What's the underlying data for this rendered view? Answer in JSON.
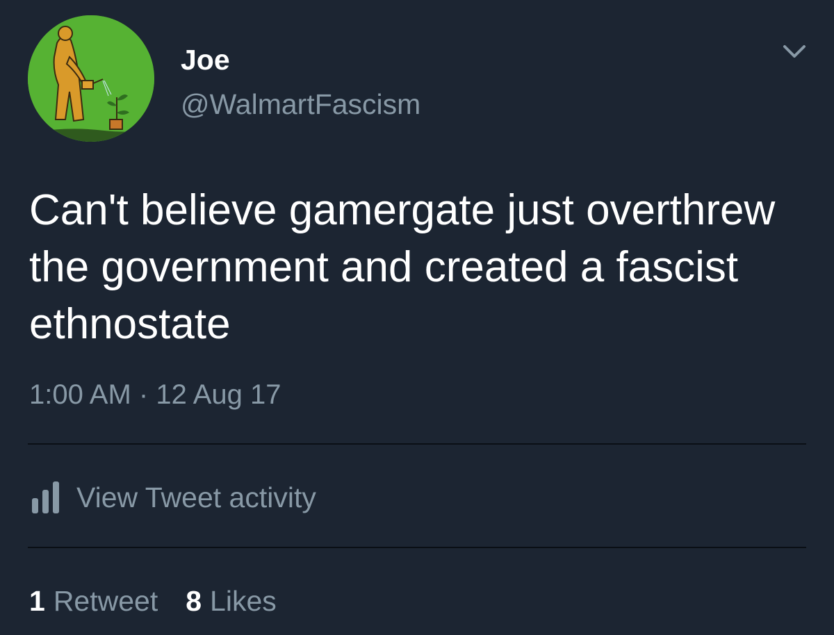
{
  "tweet": {
    "author": {
      "display_name": "Joe",
      "handle": "@WalmartFascism",
      "avatar_icon": "man-watering-plant-avatar"
    },
    "menu_icon": "chevron-down-icon",
    "text": "Can't believe gamergate just overthrew the government and created a fascist ethnostate",
    "time": "1:00 AM",
    "separator": "·",
    "date": "12 Aug 17",
    "activity": {
      "icon": "bar-chart-icon",
      "label": "View Tweet activity"
    },
    "stats": {
      "retweets": {
        "count": "1",
        "label": "Retweet"
      },
      "likes": {
        "count": "8",
        "label": "Likes"
      }
    }
  },
  "colors": {
    "background": "#1c2532",
    "primary_text": "#ffffff",
    "secondary_text": "#8899a6",
    "divider": "#0a0f15",
    "avatar_bg": "#56b233"
  }
}
